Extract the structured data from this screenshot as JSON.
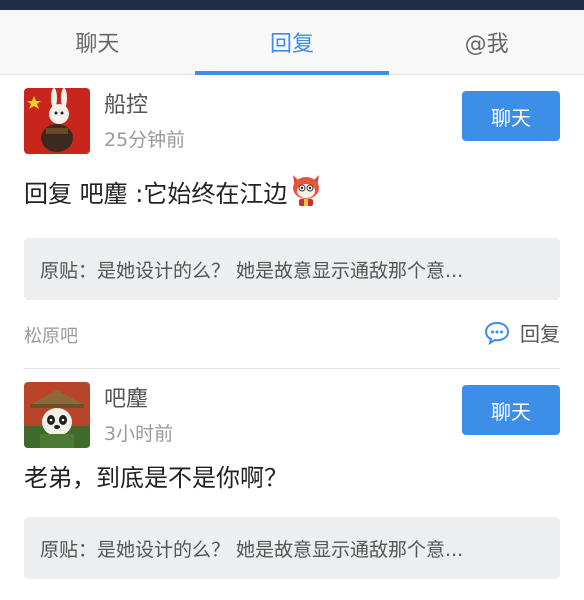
{
  "tabs": [
    {
      "label": "聊天",
      "active": false
    },
    {
      "label": "回复",
      "active": true
    },
    {
      "label": "@我",
      "active": false
    }
  ],
  "posts": [
    {
      "user": "船控",
      "time": "25分钟前",
      "chat_label": "聊天",
      "reply_text": "回复 吧麈 :它始终在江边",
      "quote": "原贴：是她设计的么？ 她是故意显示通敌那个意...",
      "forum": "松原吧",
      "reply_action": "回复"
    },
    {
      "user": "吧麈",
      "time": "3小时前",
      "chat_label": "聊天",
      "reply_text": "老弟，到底是不是你啊？",
      "quote": "原贴：是她设计的么？ 她是故意显示通敌那个意..."
    }
  ],
  "colors": {
    "accent": "#3d8ee6",
    "topbar": "#1f2d45",
    "quote_bg": "#eceeef"
  }
}
